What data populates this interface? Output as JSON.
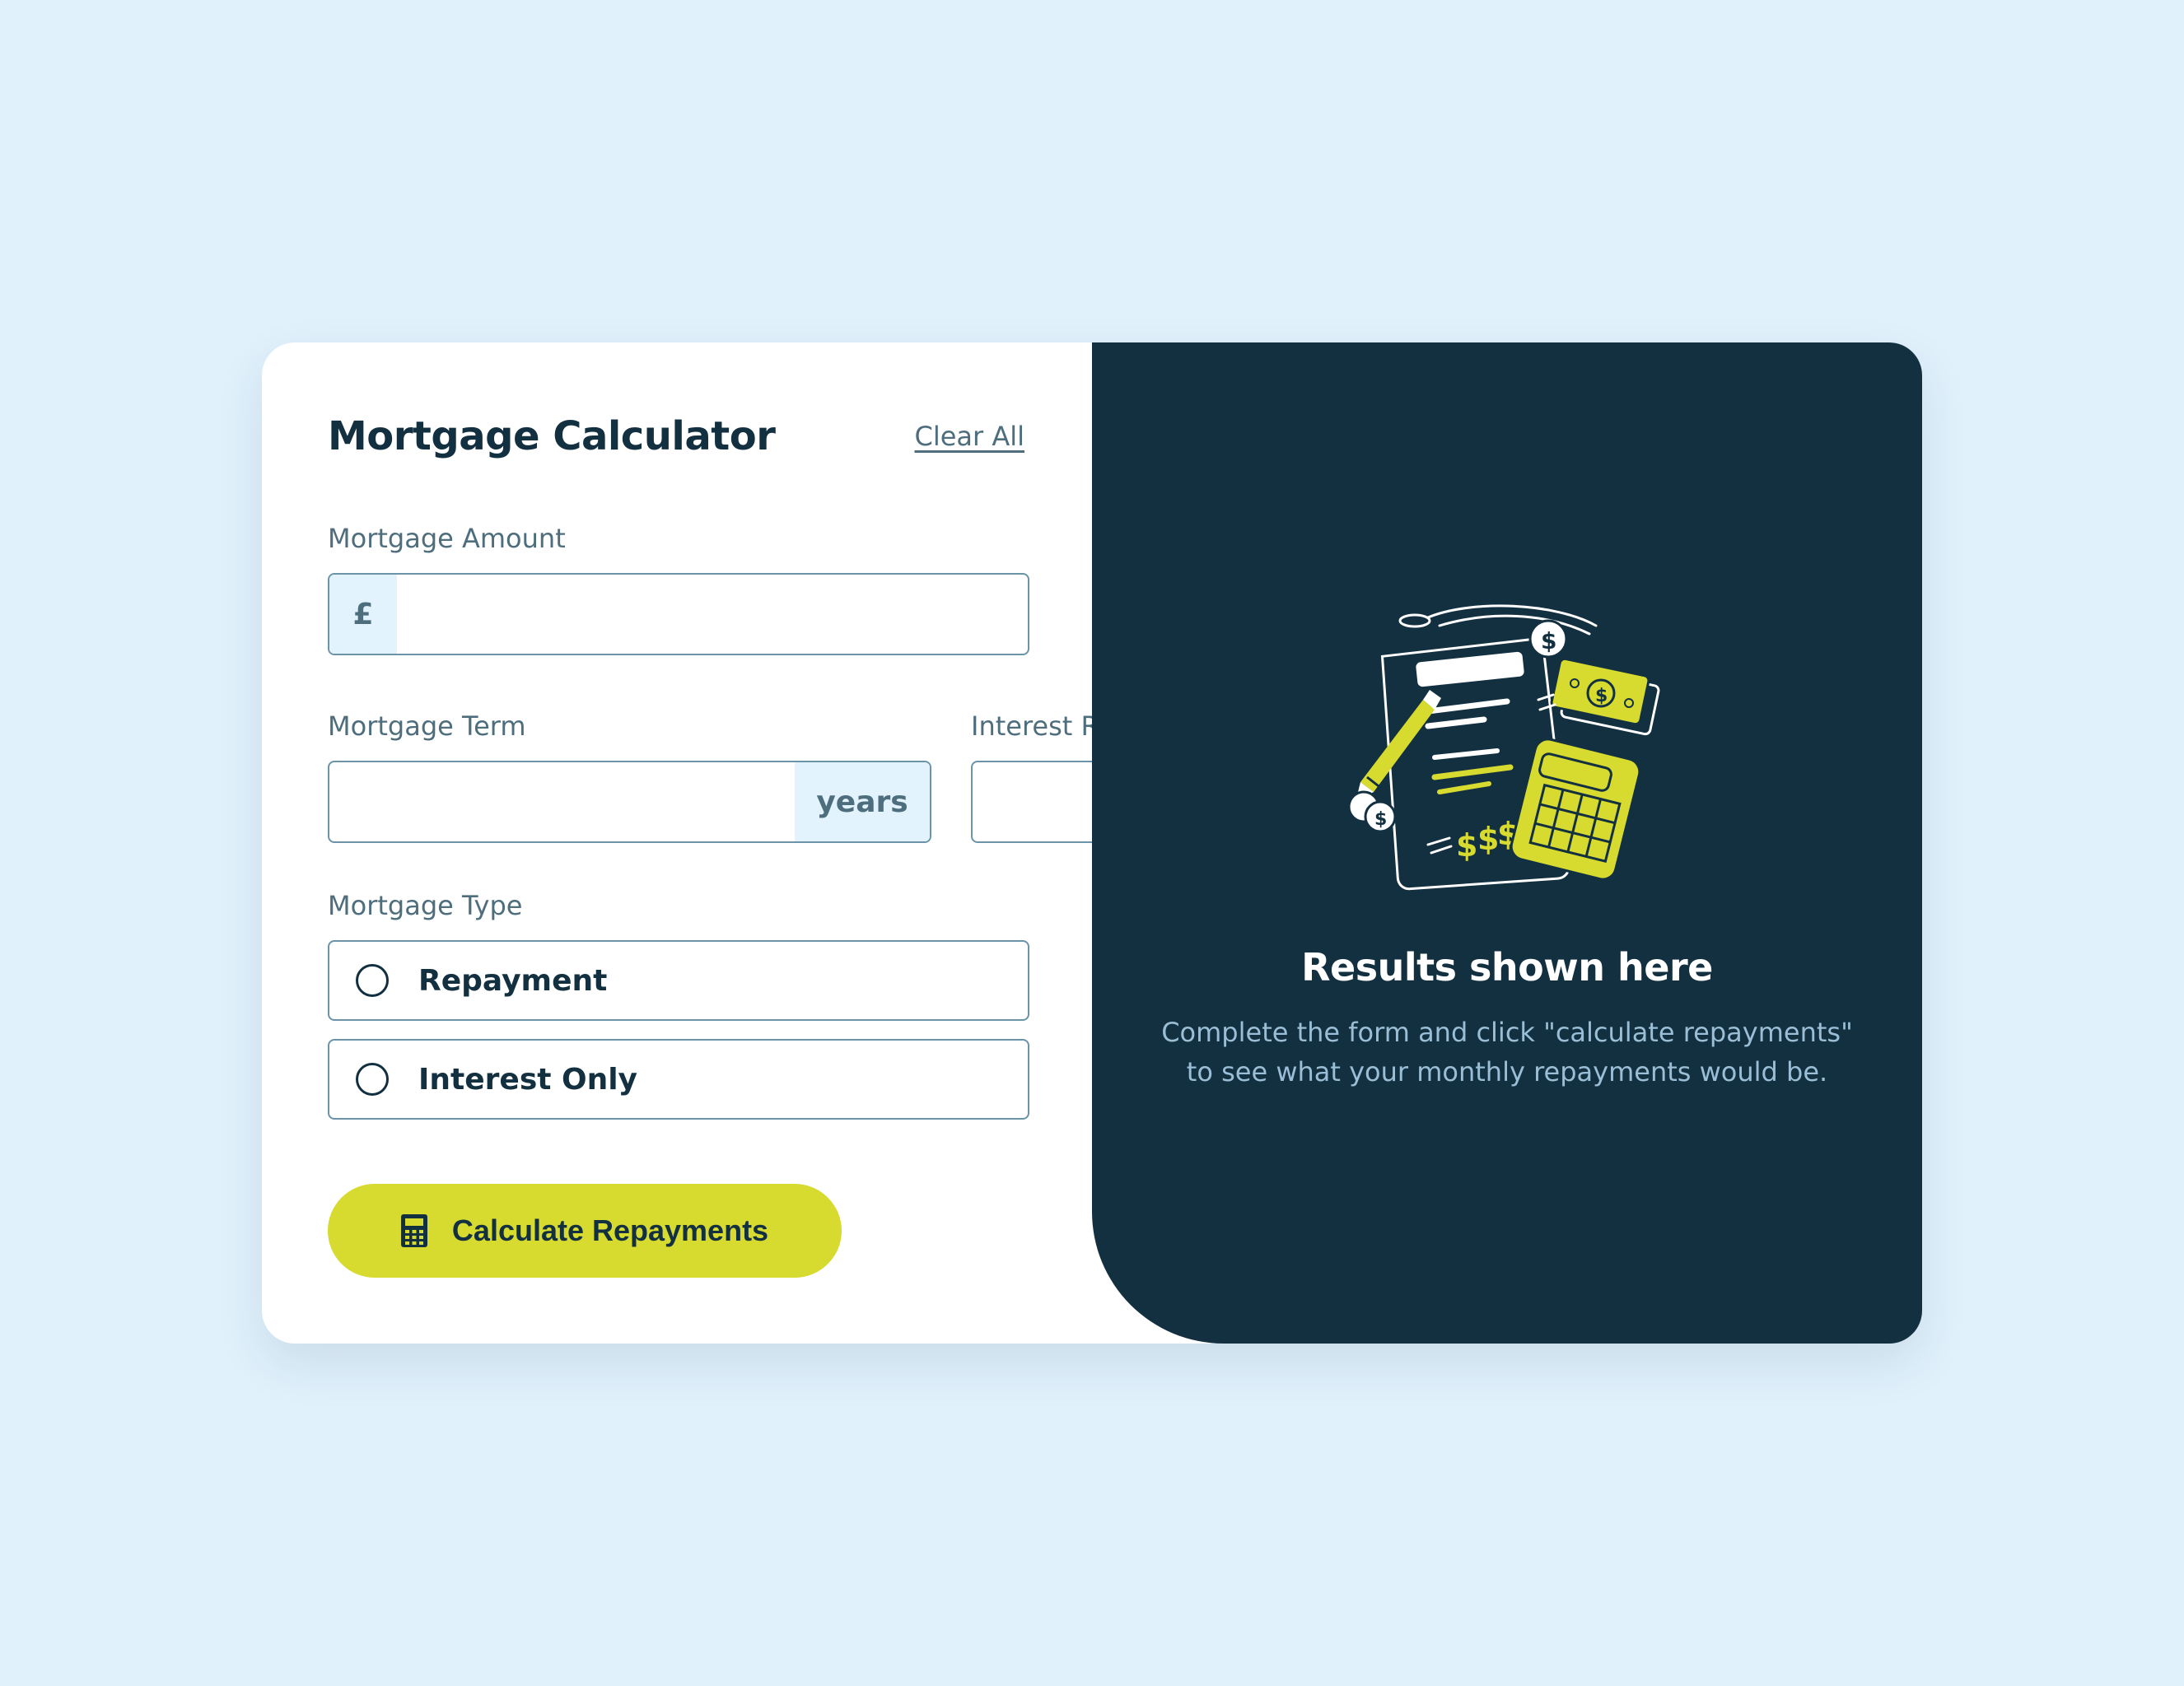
{
  "colors": {
    "background": "#e0f1fc",
    "card": "#ffffff",
    "dark": "#133041",
    "accent_lime": "#d7da2f",
    "muted_text": "#4e6e7e",
    "affix_bg": "#e3f3fd",
    "results_text": "#9abed5"
  },
  "header": {
    "title": "Mortgage Calculator",
    "clear_all": "Clear All"
  },
  "form": {
    "amount": {
      "label": "Mortgage Amount",
      "prefix": "£",
      "value": ""
    },
    "term": {
      "label": "Mortgage Term",
      "suffix": "years",
      "value": ""
    },
    "rate": {
      "label": "Interest Rate",
      "suffix": "%",
      "value": ""
    },
    "type": {
      "label": "Mortgage Type",
      "options": [
        {
          "label": "Repayment",
          "selected": false
        },
        {
          "label": "Interest Only",
          "selected": false
        }
      ]
    },
    "submit": {
      "label": "Calculate Repayments",
      "icon": "calculator-icon"
    }
  },
  "results": {
    "illustration": "empty-results-illustration",
    "title": "Results shown here",
    "description": "Complete the form and click \"calculate repayments\" to see what your monthly repayments would be."
  }
}
